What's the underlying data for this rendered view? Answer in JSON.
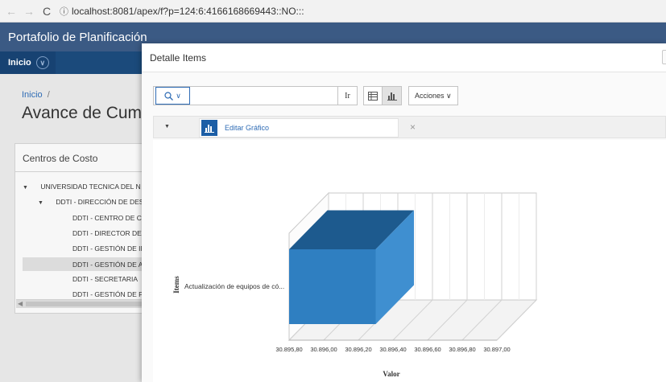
{
  "browser": {
    "back": "←",
    "forward": "→",
    "reload": "C",
    "info": "ⓘ",
    "url": "localhost:8081/apex/f?p=124:6:4166168669443::NO:::"
  },
  "app": {
    "title": "Portafolio de Planificación"
  },
  "nav": {
    "home_label": "Inicio",
    "home_chevron": "∨"
  },
  "background_page": {
    "breadcrumb": "Inicio",
    "breadcrumb_sep": "/",
    "title": "Avance de Cumpl",
    "panel_title": "Centros de Costo",
    "tree": [
      {
        "label": "UNIVERSIDAD TECNICA DEL N",
        "toggle": "▼"
      },
      {
        "label": "DDTI - DIRECCIÓN DE DES",
        "toggle": "▼"
      },
      {
        "label": "DDTI - CENTRO DE CA",
        "toggle": ""
      },
      {
        "label": "DDTI - DIRECTOR DE D",
        "toggle": ""
      },
      {
        "label": "DDTI - GESTIÓN DE IN",
        "toggle": ""
      },
      {
        "label": "DDTI - GESTIÓN DE AT",
        "toggle": ""
      },
      {
        "label": "DDTI - SECRETARIA",
        "toggle": ""
      },
      {
        "label": "DDTI - GESTIÓN DE PL",
        "toggle": ""
      }
    ],
    "scroll_arrow": "◀"
  },
  "dialog": {
    "title": "Detalle Items",
    "search": {
      "icon": "search-icon",
      "chevron": "∨",
      "value": "",
      "placeholder": ""
    },
    "go_label": "Ir",
    "actions_label": "Acciones ∨",
    "filter_toggle": "▼",
    "edit_chart_label": "Editar Gráfico",
    "remove_label": "×"
  },
  "colors": {
    "header": "#3b5a84",
    "navbar": "#1b4a7b",
    "bar_front": "#2f7fc1",
    "bar_top": "#1d5a8e",
    "bar_side": "#3f8fd0",
    "link": "#2f6cb5"
  },
  "chart_data": {
    "type": "bar",
    "orientation": "horizontal",
    "three_d": true,
    "categories": [
      "Actualización de equipos de có..."
    ],
    "values": [
      30896.3
    ],
    "xlabel": "Valor",
    "ylabel": "Items",
    "xticks": [
      "30.895,80",
      "30.896,00",
      "30.896,20",
      "30.896,40",
      "30.896,60",
      "30.896,80",
      "30.897,00"
    ],
    "xlim": [
      30895.8,
      30897.0
    ],
    "grid": true
  }
}
